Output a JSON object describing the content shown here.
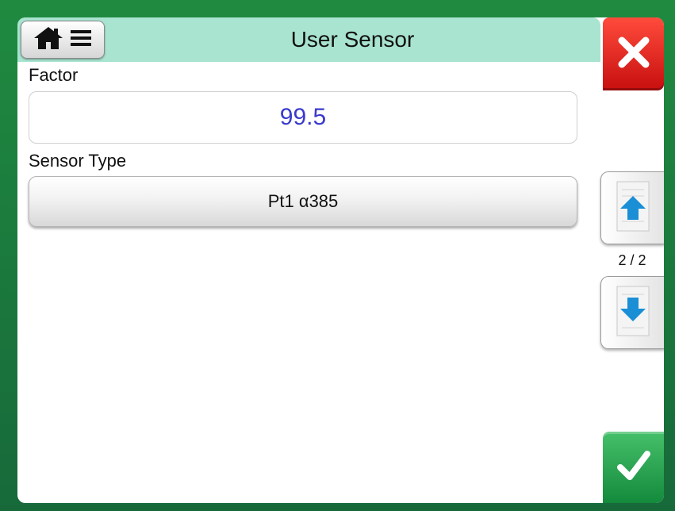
{
  "header": {
    "title": "User Sensor"
  },
  "factor": {
    "label": "Factor",
    "value": "99.5"
  },
  "sensor_type": {
    "label": "Sensor Type",
    "value": "Pt1 α385"
  },
  "pager": {
    "indicator": "2 / 2"
  },
  "icons": {
    "home": "home-icon",
    "menu": "menu-icon",
    "close": "close-icon",
    "page_up": "page-up-icon",
    "page_down": "page-down-icon",
    "accept": "checkmark-icon"
  },
  "colors": {
    "frame": "#1f8a40",
    "title_bar": "#a8e4d0",
    "close": "#e0201a",
    "accept": "#2aa552",
    "value_text": "#3a3acc",
    "arrow": "#1a8fd6"
  }
}
